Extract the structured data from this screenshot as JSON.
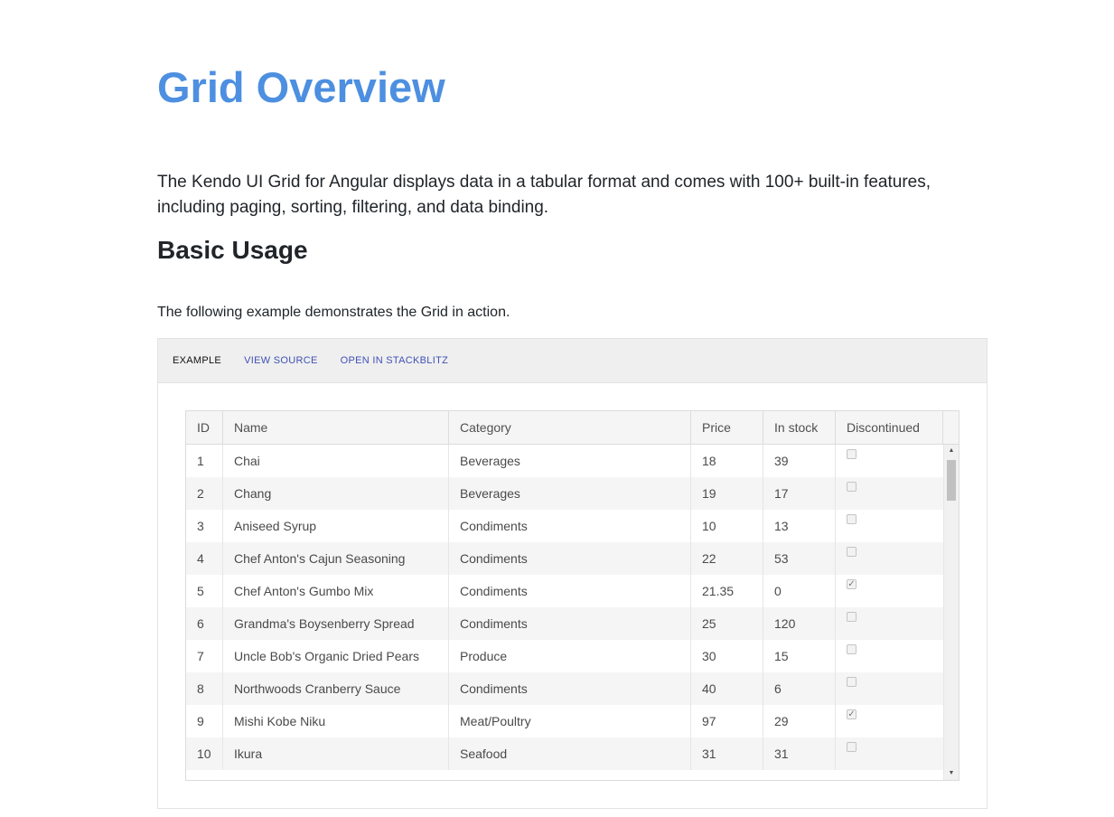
{
  "page": {
    "title": "Grid Overview",
    "intro": "The Kendo UI Grid for Angular displays data in a tabular format and comes with 100+ built-in features, including paging, sorting, filtering, and data binding.",
    "section_title": "Basic Usage",
    "example_desc": "The following example demonstrates the Grid in action."
  },
  "example_tabs": {
    "example": "EXAMPLE",
    "view_source": "VIEW SOURCE",
    "open_stackblitz": "OPEN IN STACKBLITZ"
  },
  "grid": {
    "columns": {
      "id": "ID",
      "name": "Name",
      "category": "Category",
      "price": "Price",
      "stock": "In stock",
      "discontinued": "Discontinued"
    },
    "rows": [
      {
        "id": "1",
        "name": "Chai",
        "category": "Beverages",
        "price": "18",
        "stock": "39",
        "discontinued": false
      },
      {
        "id": "2",
        "name": "Chang",
        "category": "Beverages",
        "price": "19",
        "stock": "17",
        "discontinued": false
      },
      {
        "id": "3",
        "name": "Aniseed Syrup",
        "category": "Condiments",
        "price": "10",
        "stock": "13",
        "discontinued": false
      },
      {
        "id": "4",
        "name": "Chef Anton's Cajun Seasoning",
        "category": "Condiments",
        "price": "22",
        "stock": "53",
        "discontinued": false
      },
      {
        "id": "5",
        "name": "Chef Anton's Gumbo Mix",
        "category": "Condiments",
        "price": "21.35",
        "stock": "0",
        "discontinued": true
      },
      {
        "id": "6",
        "name": "Grandma's Boysenberry Spread",
        "category": "Condiments",
        "price": "25",
        "stock": "120",
        "discontinued": false
      },
      {
        "id": "7",
        "name": "Uncle Bob's Organic Dried Pears",
        "category": "Produce",
        "price": "30",
        "stock": "15",
        "discontinued": false
      },
      {
        "id": "8",
        "name": "Northwoods Cranberry Sauce",
        "category": "Condiments",
        "price": "40",
        "stock": "6",
        "discontinued": false
      },
      {
        "id": "9",
        "name": "Mishi Kobe Niku",
        "category": "Meat/Poultry",
        "price": "97",
        "stock": "29",
        "discontinued": true
      },
      {
        "id": "10",
        "name": "Ikura",
        "category": "Seafood",
        "price": "31",
        "stock": "31",
        "discontinued": false
      }
    ]
  },
  "icons": {
    "scroll_up": "▲",
    "scroll_down": "▼",
    "check": "✓"
  }
}
